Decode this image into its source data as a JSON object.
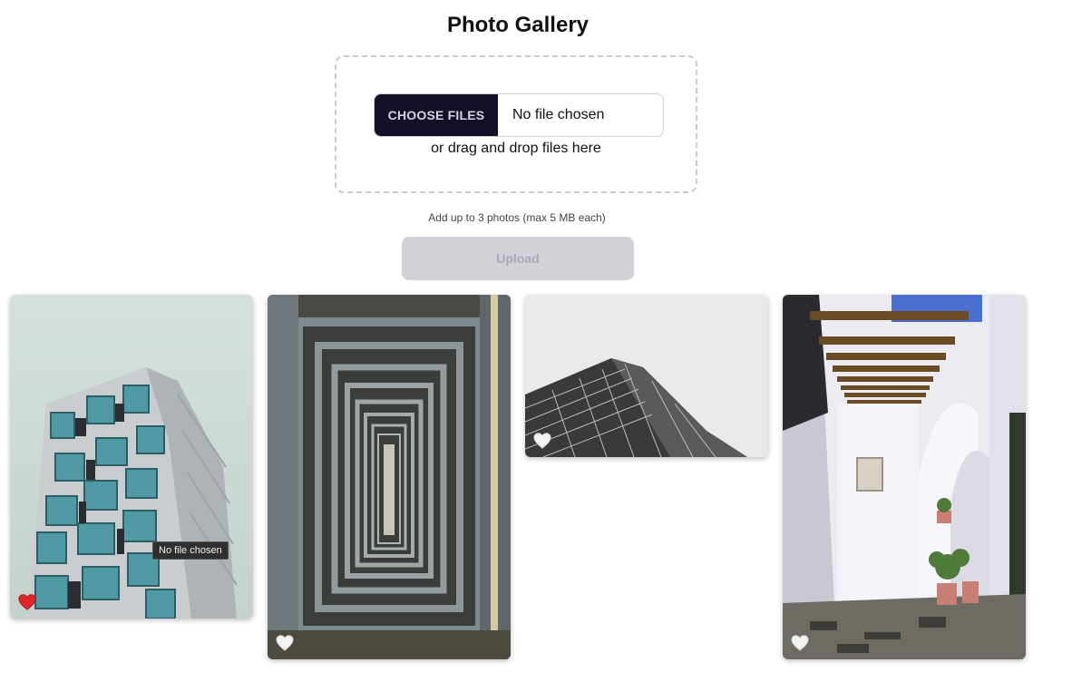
{
  "header": {
    "title": "Photo Gallery"
  },
  "uploader": {
    "choose_label": "CHOOSE FILES",
    "file_status": "No file chosen",
    "drop_hint": "or drag and drop files here",
    "limit_note": "Add up to 3 photos (max 5 MB each)",
    "upload_label": "Upload"
  },
  "tooltip": {
    "text": "No file chosen"
  },
  "gallery": {
    "photos": [
      {
        "subject": "stacked teal modular apartment tower",
        "liked": true
      },
      {
        "subject": "concrete corridor of repeating arches",
        "liked": false
      },
      {
        "subject": "low-angle glass skyscraper against grey sky",
        "liked": false
      },
      {
        "subject": "white courtyard with wooden pergola and potted plants",
        "liked": false
      }
    ]
  },
  "colors": {
    "choose_button_bg": "#150f2a",
    "upload_disabled_bg": "#d2d1d8",
    "heart_liked": "#e0242b",
    "heart_unliked": "#f2f2f2"
  }
}
